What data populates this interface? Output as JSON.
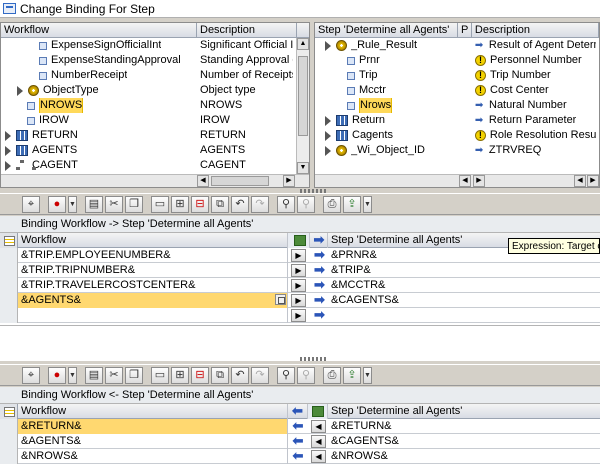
{
  "window": {
    "title": "Change Binding For Step"
  },
  "workflow_tree": {
    "columns": [
      "Workflow",
      "Description"
    ],
    "rows": [
      {
        "indent": 2,
        "icon": "element-icon",
        "name": "ExpenseSignOfficialInt",
        "desc": "Significant Official Inte"
      },
      {
        "indent": 2,
        "icon": "element-icon",
        "name": "ExpenseStandingApproval",
        "desc": "Standing Approval of E"
      },
      {
        "indent": 2,
        "icon": "element-icon",
        "name": "NumberReceipt",
        "desc": "Number of Receipts"
      },
      {
        "indent": 1,
        "icon": "object-icon",
        "expand": true,
        "name": "ObjectType",
        "desc": "Object type"
      },
      {
        "indent": 1,
        "icon": "element-icon",
        "name": "NROWS",
        "desc": "NROWS",
        "highlight": true
      },
      {
        "indent": 1,
        "icon": "element-icon",
        "name": "IROW",
        "desc": "IROW"
      },
      {
        "indent": 0,
        "icon": "table-icon",
        "expand": true,
        "name": "RETURN",
        "desc": "RETURN"
      },
      {
        "indent": 0,
        "icon": "table-icon",
        "expand": true,
        "name": "AGENTS",
        "desc": "AGENTS"
      },
      {
        "indent": 0,
        "icon": "org-icon",
        "expand": true,
        "name": "CAGENT",
        "desc": "CAGENT"
      }
    ]
  },
  "step_tree": {
    "columns": [
      "Step 'Determine all Agents'",
      "P",
      "Description"
    ],
    "rows": [
      {
        "indent": 1,
        "icon": "object-icon",
        "expand": true,
        "name": "_Rule_Result",
        "p": "",
        "p_icon": "arrow-icon",
        "desc": "Result of Agent Determinatio"
      },
      {
        "indent": 2,
        "icon": "element-icon",
        "name": "Prnr",
        "p": "",
        "p_icon": "warning-icon",
        "desc": "Personnel Number"
      },
      {
        "indent": 2,
        "icon": "element-icon",
        "name": "Trip",
        "p": "",
        "p_icon": "warning-icon",
        "desc": "Trip Number"
      },
      {
        "indent": 2,
        "icon": "element-icon",
        "name": "Mcctr",
        "p": "",
        "p_icon": "warning-icon",
        "desc": "Cost Center"
      },
      {
        "indent": 2,
        "icon": "element-icon",
        "name": "Nrows",
        "p": "",
        "p_icon": "arrow-icon",
        "desc": "Natural Number",
        "highlight": true
      },
      {
        "indent": 1,
        "icon": "table-icon",
        "expand": true,
        "name": "Return",
        "p": "",
        "p_icon": "arrow-icon",
        "desc": "Return Parameter"
      },
      {
        "indent": 1,
        "icon": "table-icon",
        "expand": true,
        "name": "Cagents",
        "p": "",
        "p_icon": "warning-icon",
        "desc": "Role Resolution Result"
      },
      {
        "indent": 1,
        "icon": "object-icon",
        "expand": true,
        "name": "_Wi_Object_ID",
        "p": "",
        "p_icon": "arrow-icon",
        "desc": "ZTRVREQ"
      }
    ]
  },
  "toolbar_icons": [
    "details-icon",
    "insert-icon",
    "paste-icon",
    "cut-icon",
    "copy-icon",
    "new-row-icon",
    "insert-row-icon",
    "delete-row-icon",
    "duplicate-icon",
    "undo-icon",
    "redo-icon",
    "find-icon",
    "find-next-icon",
    "print-icon",
    "export-icon"
  ],
  "binding_to_step": {
    "title": "Binding Workflow -> Step 'Determine all Agents'",
    "col_workflow": "Workflow",
    "col_step": "Step 'Determine all Agents'",
    "rows": [
      {
        "workflow": "&TRIP.EMPLOYEENUMBER&",
        "step": "&PRNR&"
      },
      {
        "workflow": "&TRIP.TRIPNUMBER&",
        "step": "&TRIP&"
      },
      {
        "workflow": "&TRIP.TRAVELERCOSTCENTER&",
        "step": "&MCCTR&"
      },
      {
        "workflow": "&AGENTS&",
        "step": "&CAGENTS&",
        "highlight": true
      },
      {
        "workflow": "",
        "step": ""
      }
    ]
  },
  "tooltip": {
    "text": "Expression: Target of A"
  },
  "binding_from_step": {
    "title": "Binding Workflow <- Step 'Determine all Agents'",
    "col_workflow": "Workflow",
    "col_step": "Step 'Determine all Agents'",
    "rows": [
      {
        "workflow": "&RETURN&",
        "step": "&RETURN&",
        "highlight": true
      },
      {
        "workflow": "&AGENTS&",
        "step": "&CAGENTS&"
      },
      {
        "workflow": "&NROWS&",
        "step": "&NROWS&"
      }
    ]
  }
}
